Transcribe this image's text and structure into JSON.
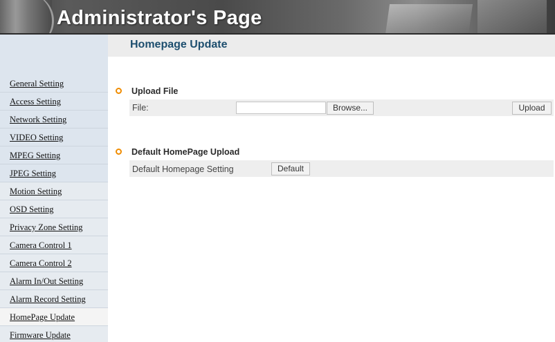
{
  "header": {
    "title": "Administrator's Page"
  },
  "sidebar": {
    "items": [
      {
        "label": "General Setting"
      },
      {
        "label": "Access Setting"
      },
      {
        "label": "Network Setting"
      },
      {
        "label": "VIDEO Setting"
      },
      {
        "label": "MPEG Setting"
      },
      {
        "label": "JPEG Setting"
      },
      {
        "label": "Motion Setting"
      },
      {
        "label": "OSD Setting"
      },
      {
        "label": "Privacy Zone Setting"
      },
      {
        "label": "Camera Control 1"
      },
      {
        "label": "Camera Control 2"
      },
      {
        "label": "Alarm In/Out Setting"
      },
      {
        "label": "Alarm Record Setting"
      },
      {
        "label": "HomePage Update"
      },
      {
        "label": "Firmware Update"
      }
    ],
    "active": "HomePage Update"
  },
  "main": {
    "title": "Homepage Update",
    "upload_section": {
      "title": "Upload File",
      "file_label": "File:",
      "file_value": "",
      "browse_label": "Browse...",
      "upload_label": "Upload"
    },
    "default_section": {
      "title": "Default HomePage Upload",
      "setting_label": "Default Homepage Setting",
      "default_label": "Default"
    }
  },
  "colors": {
    "accent_orange": "#f08c00",
    "title_blue": "#1d4e6e",
    "sidebar_bg": "#dde5ee"
  }
}
